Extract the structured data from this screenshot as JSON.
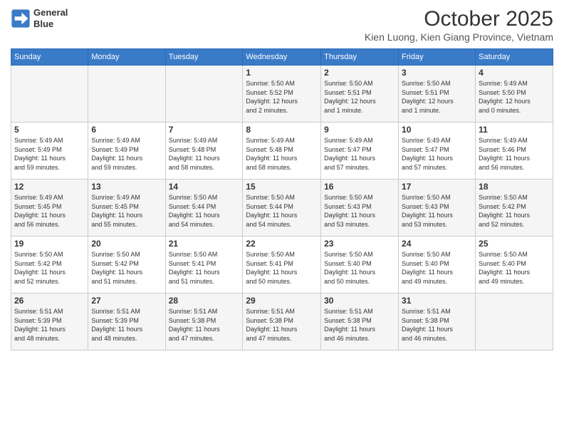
{
  "header": {
    "logo_line1": "General",
    "logo_line2": "Blue",
    "month_title": "October 2025",
    "location": "Kien Luong, Kien Giang Province, Vietnam"
  },
  "days_of_week": [
    "Sunday",
    "Monday",
    "Tuesday",
    "Wednesday",
    "Thursday",
    "Friday",
    "Saturday"
  ],
  "weeks": [
    [
      {
        "day": "",
        "info": ""
      },
      {
        "day": "",
        "info": ""
      },
      {
        "day": "",
        "info": ""
      },
      {
        "day": "1",
        "info": "Sunrise: 5:50 AM\nSunset: 5:52 PM\nDaylight: 12 hours\nand 2 minutes."
      },
      {
        "day": "2",
        "info": "Sunrise: 5:50 AM\nSunset: 5:51 PM\nDaylight: 12 hours\nand 1 minute."
      },
      {
        "day": "3",
        "info": "Sunrise: 5:50 AM\nSunset: 5:51 PM\nDaylight: 12 hours\nand 1 minute."
      },
      {
        "day": "4",
        "info": "Sunrise: 5:49 AM\nSunset: 5:50 PM\nDaylight: 12 hours\nand 0 minutes."
      }
    ],
    [
      {
        "day": "5",
        "info": "Sunrise: 5:49 AM\nSunset: 5:49 PM\nDaylight: 11 hours\nand 59 minutes."
      },
      {
        "day": "6",
        "info": "Sunrise: 5:49 AM\nSunset: 5:49 PM\nDaylight: 11 hours\nand 59 minutes."
      },
      {
        "day": "7",
        "info": "Sunrise: 5:49 AM\nSunset: 5:48 PM\nDaylight: 11 hours\nand 58 minutes."
      },
      {
        "day": "8",
        "info": "Sunrise: 5:49 AM\nSunset: 5:48 PM\nDaylight: 11 hours\nand 58 minutes."
      },
      {
        "day": "9",
        "info": "Sunrise: 5:49 AM\nSunset: 5:47 PM\nDaylight: 11 hours\nand 57 minutes."
      },
      {
        "day": "10",
        "info": "Sunrise: 5:49 AM\nSunset: 5:47 PM\nDaylight: 11 hours\nand 57 minutes."
      },
      {
        "day": "11",
        "info": "Sunrise: 5:49 AM\nSunset: 5:46 PM\nDaylight: 11 hours\nand 56 minutes."
      }
    ],
    [
      {
        "day": "12",
        "info": "Sunrise: 5:49 AM\nSunset: 5:45 PM\nDaylight: 11 hours\nand 56 minutes."
      },
      {
        "day": "13",
        "info": "Sunrise: 5:49 AM\nSunset: 5:45 PM\nDaylight: 11 hours\nand 55 minutes."
      },
      {
        "day": "14",
        "info": "Sunrise: 5:50 AM\nSunset: 5:44 PM\nDaylight: 11 hours\nand 54 minutes."
      },
      {
        "day": "15",
        "info": "Sunrise: 5:50 AM\nSunset: 5:44 PM\nDaylight: 11 hours\nand 54 minutes."
      },
      {
        "day": "16",
        "info": "Sunrise: 5:50 AM\nSunset: 5:43 PM\nDaylight: 11 hours\nand 53 minutes."
      },
      {
        "day": "17",
        "info": "Sunrise: 5:50 AM\nSunset: 5:43 PM\nDaylight: 11 hours\nand 53 minutes."
      },
      {
        "day": "18",
        "info": "Sunrise: 5:50 AM\nSunset: 5:42 PM\nDaylight: 11 hours\nand 52 minutes."
      }
    ],
    [
      {
        "day": "19",
        "info": "Sunrise: 5:50 AM\nSunset: 5:42 PM\nDaylight: 11 hours\nand 52 minutes."
      },
      {
        "day": "20",
        "info": "Sunrise: 5:50 AM\nSunset: 5:42 PM\nDaylight: 11 hours\nand 51 minutes."
      },
      {
        "day": "21",
        "info": "Sunrise: 5:50 AM\nSunset: 5:41 PM\nDaylight: 11 hours\nand 51 minutes."
      },
      {
        "day": "22",
        "info": "Sunrise: 5:50 AM\nSunset: 5:41 PM\nDaylight: 11 hours\nand 50 minutes."
      },
      {
        "day": "23",
        "info": "Sunrise: 5:50 AM\nSunset: 5:40 PM\nDaylight: 11 hours\nand 50 minutes."
      },
      {
        "day": "24",
        "info": "Sunrise: 5:50 AM\nSunset: 5:40 PM\nDaylight: 11 hours\nand 49 minutes."
      },
      {
        "day": "25",
        "info": "Sunrise: 5:50 AM\nSunset: 5:40 PM\nDaylight: 11 hours\nand 49 minutes."
      }
    ],
    [
      {
        "day": "26",
        "info": "Sunrise: 5:51 AM\nSunset: 5:39 PM\nDaylight: 11 hours\nand 48 minutes."
      },
      {
        "day": "27",
        "info": "Sunrise: 5:51 AM\nSunset: 5:39 PM\nDaylight: 11 hours\nand 48 minutes."
      },
      {
        "day": "28",
        "info": "Sunrise: 5:51 AM\nSunset: 5:38 PM\nDaylight: 11 hours\nand 47 minutes."
      },
      {
        "day": "29",
        "info": "Sunrise: 5:51 AM\nSunset: 5:38 PM\nDaylight: 11 hours\nand 47 minutes."
      },
      {
        "day": "30",
        "info": "Sunrise: 5:51 AM\nSunset: 5:38 PM\nDaylight: 11 hours\nand 46 minutes."
      },
      {
        "day": "31",
        "info": "Sunrise: 5:51 AM\nSunset: 5:38 PM\nDaylight: 11 hours\nand 46 minutes."
      },
      {
        "day": "",
        "info": ""
      }
    ]
  ]
}
